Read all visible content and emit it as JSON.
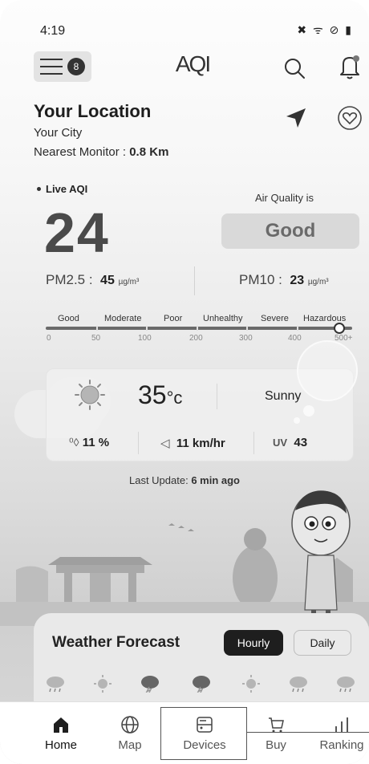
{
  "status_bar": {
    "time": "4:19",
    "icons": "✖ ᯤ ⊘ ▮"
  },
  "header": {
    "logo": "AQI",
    "menu_avatar": "8"
  },
  "location": {
    "title": "Your Location",
    "city": "Your City",
    "monitor_label": "Nearest Monitor : ",
    "monitor_distance": "0.8 Km"
  },
  "aqi": {
    "live_label": "Live AQI",
    "value": "24",
    "air_quality_label": "Air Quality is",
    "status": "Good",
    "pm25_label": "PM2.5 :",
    "pm25_value": "45",
    "pm25_unit": "µg/m³",
    "pm10_label": "PM10 :",
    "pm10_value": "23",
    "pm10_unit": "µg/m³",
    "scale_labels": [
      "Good",
      "Moderate",
      "Poor",
      "Unhealthy",
      "Severe",
      "Hazardous"
    ],
    "scale_numbers": [
      "0",
      "50",
      "100",
      "200",
      "300",
      "400",
      "500+"
    ]
  },
  "weather": {
    "temperature": "35",
    "temp_unit": "°c",
    "condition": "Sunny",
    "humidity": "11 %",
    "wind": "11 km/hr",
    "uv": "43",
    "last_update_label": "Last Update: ",
    "last_update_value": "6 min ago"
  },
  "forecast": {
    "title": "Weather Forecast",
    "hourly_label": "Hourly",
    "daily_label": "Daily",
    "icons": [
      "rain-cloud-icon",
      "sun-icon",
      "storm-cloud-icon",
      "storm-cloud-icon",
      "sun-icon",
      "rain-cloud-icon",
      "rain-cloud-icon"
    ]
  },
  "bottom_nav": {
    "home": "Home",
    "map": "Map",
    "devices": "Devices",
    "buy": "Buy",
    "ranking": "Ranking"
  },
  "colors": {
    "accent_dark": "#1e1e1e",
    "status_box": "#d9d9d9",
    "aqi_number": "#4a4a4a"
  }
}
